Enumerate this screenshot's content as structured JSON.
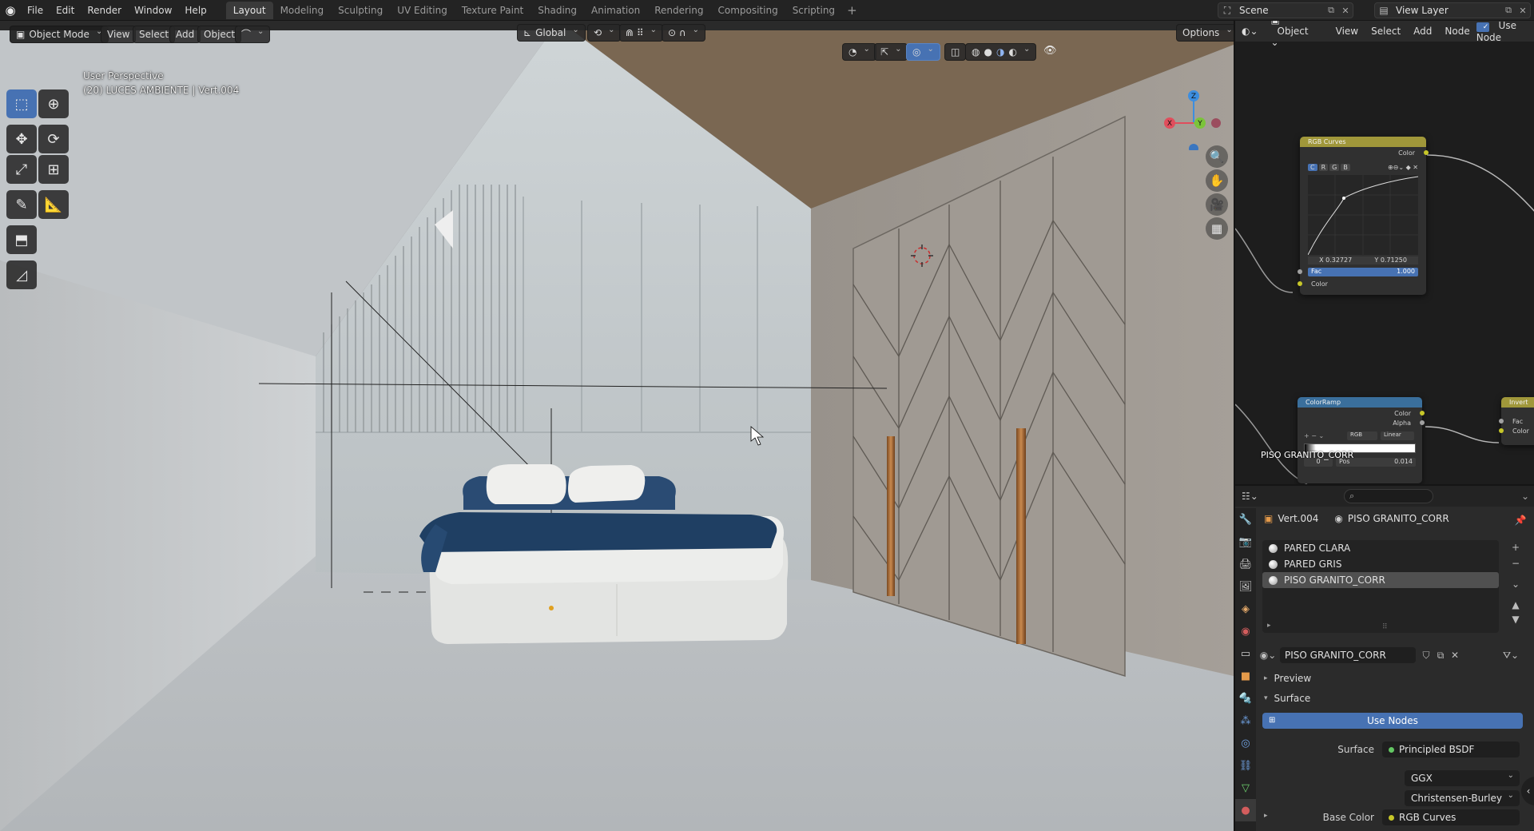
{
  "topbar": {
    "menus": [
      "File",
      "Edit",
      "Render",
      "Window",
      "Help"
    ],
    "workspaces": [
      "Layout",
      "Modeling",
      "Sculpting",
      "UV Editing",
      "Texture Paint",
      "Shading",
      "Animation",
      "Rendering",
      "Compositing",
      "Scripting"
    ],
    "active_workspace": "Layout",
    "scene": "Scene",
    "view_layer": "View Layer"
  },
  "viewport": {
    "mode": "Object Mode",
    "menus": [
      "View",
      "Select",
      "Add",
      "Object"
    ],
    "transform_orientation": "Global",
    "options_label": "Options",
    "info_line1": "User Perspective",
    "info_line2": "(20) LUCES AMBIENTE | Vert.004",
    "gizmo": {
      "x": "X",
      "y": "Y",
      "z": "Z"
    }
  },
  "node_editor": {
    "editor_type": "Object",
    "menus": [
      "View",
      "Select",
      "Add",
      "Node"
    ],
    "use_nodes_label": "Use Node",
    "rgb_curves": {
      "title": "RGB Curves",
      "out_color": "Color",
      "channels": [
        "C",
        "R",
        "G",
        "B"
      ],
      "x_value": "X 0.32727",
      "y_value": "Y 0.71250",
      "fac_label": "Fac",
      "fac_value": "1.000",
      "in_color": "Color"
    },
    "color_ramp": {
      "title": "ColorRamp",
      "out_color": "Color",
      "out_alpha": "Alpha",
      "mode": "RGB",
      "interp": "Linear",
      "index": "0",
      "pos_label": "Pos",
      "pos_value": "0.014"
    },
    "invert": {
      "title": "Invert",
      "fac": "Fac",
      "color": "Color"
    },
    "overlay_label": "PISO GRANITO_CORR"
  },
  "properties": {
    "object_name": "Vert.004",
    "material_name": "PISO GRANITO_CORR",
    "slots": [
      "PARED CLARA",
      "PARED GRIS",
      "PISO GRANITO_CORR"
    ],
    "selected_slot": 2,
    "material_field": "PISO GRANITO_CORR",
    "preview_label": "Preview",
    "surface_label": "Surface",
    "use_nodes": "Use Nodes",
    "surface_row_label": "Surface",
    "surface_value": "Principled BSDF",
    "distribution": "GGX",
    "subsurface_method": "Christensen-Burley",
    "base_color_label": "Base Color",
    "base_color_value": "RGB Curves"
  },
  "colors": {
    "accent": "#4772b3",
    "header_bg": "#232323",
    "panel_bg": "#2b2b2b",
    "node_editor_bg": "#1d1d1d",
    "socket_yellow": "#c7c729",
    "shader_green": "#63c763"
  }
}
